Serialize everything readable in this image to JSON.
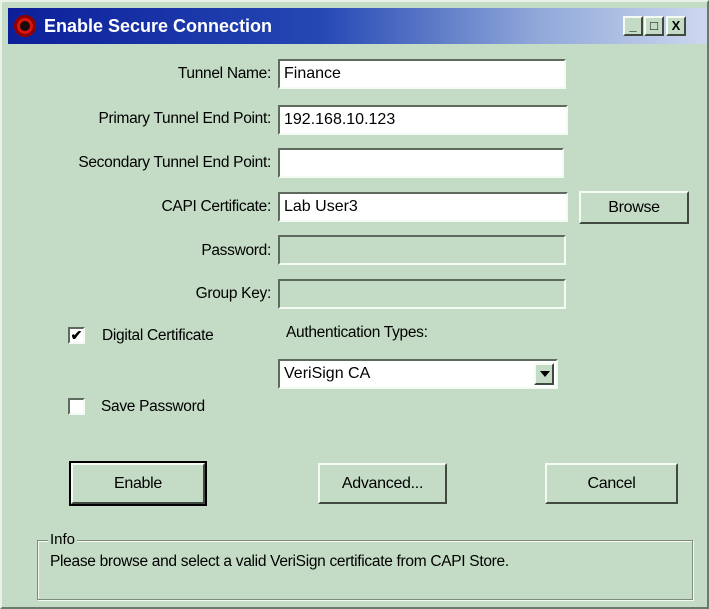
{
  "window": {
    "title": "Enable Secure Connection",
    "controls": {
      "minimize": "_",
      "maximize": "□",
      "close": "X"
    }
  },
  "form": {
    "tunnel_name": {
      "label": "Tunnel Name:",
      "value": "Finance"
    },
    "primary_end_point": {
      "label": "Primary Tunnel End Point:",
      "value": "192.168.10.123"
    },
    "secondary_end_point": {
      "label": "Secondary Tunnel End Point:",
      "value": ""
    },
    "capi_certificate": {
      "label": "CAPI Certificate:",
      "value": "Lab User3"
    },
    "browse_button": "Browse",
    "password": {
      "label": "Password:",
      "value": ""
    },
    "group_key": {
      "label": "Group Key:",
      "value": ""
    }
  },
  "options": {
    "digital_certificate": {
      "label": "Digital Certificate",
      "checked": true,
      "mark": "✔"
    },
    "save_password": {
      "label": "Save Password",
      "checked": false,
      "mark": ""
    },
    "authentication_types": {
      "label": "Authentication Types:",
      "selected": "VeriSign CA"
    }
  },
  "buttons": {
    "enable": "Enable",
    "advanced": "Advanced...",
    "cancel": "Cancel"
  },
  "info": {
    "legend": "Info",
    "message": "Please browse and select a valid VeriSign certificate from CAPI Store."
  },
  "colors": {
    "background": "#c4dcc5",
    "titlebar": "#0c1f9a"
  }
}
